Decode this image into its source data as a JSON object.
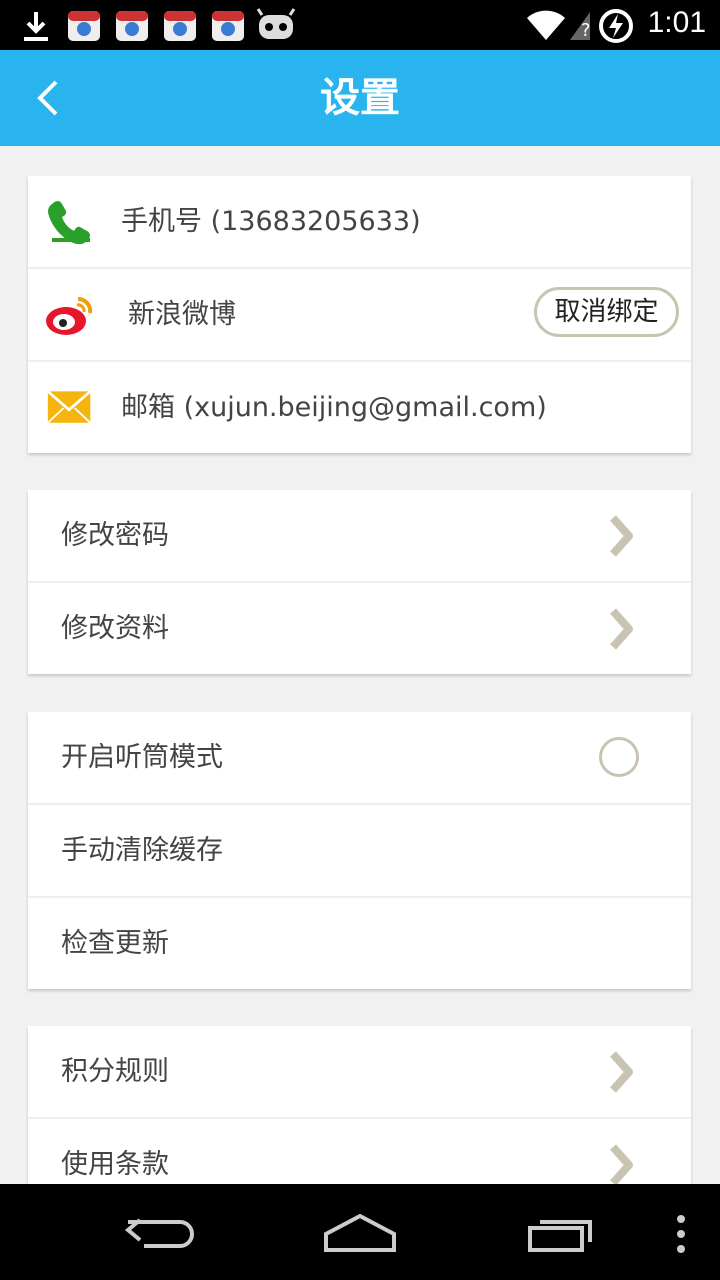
{
  "status_bar": {
    "time": "1:01",
    "icons": [
      "download-icon",
      "app-store-icon",
      "app-store-icon",
      "app-store-icon",
      "app-store-icon",
      "android-icon",
      "wifi-icon",
      "no-signal-icon",
      "charging-icon"
    ]
  },
  "header": {
    "title": "设置",
    "back_icon": "chevron-left-icon"
  },
  "accounts": {
    "phone": {
      "label": "手机号 (13683205633)",
      "icon": "phone-icon",
      "color": "#2aa02a"
    },
    "weibo": {
      "label": "新浪微博",
      "icon": "weibo-icon",
      "color": "#e6162d",
      "action_label": "取消绑定"
    },
    "email": {
      "label": "邮箱 (xujun.beijing@gmail.com)",
      "icon": "mail-icon",
      "color": "#f5b40e"
    }
  },
  "profile_section": {
    "items": [
      {
        "label": "修改密码",
        "icon": "chevron-right-icon"
      },
      {
        "label": "修改资料",
        "icon": "chevron-right-icon"
      }
    ]
  },
  "general_section": {
    "earpiece_mode": {
      "label": "开启听筒模式",
      "enabled": false
    },
    "clear_cache": {
      "label": "手动清除缓存"
    },
    "check_update": {
      "label": "检查更新"
    }
  },
  "info_section": {
    "items": [
      {
        "label": "积分规则",
        "icon": "chevron-right-icon"
      },
      {
        "label": "使用条款",
        "icon": "chevron-right-icon"
      }
    ]
  },
  "nav_bar": {
    "icons": [
      "back-icon",
      "home-icon",
      "recents-icon",
      "overflow-menu-icon"
    ]
  },
  "colors": {
    "accent": "#29b4f0",
    "background": "#f1f1f1",
    "chevron": "#c9c4b2"
  }
}
